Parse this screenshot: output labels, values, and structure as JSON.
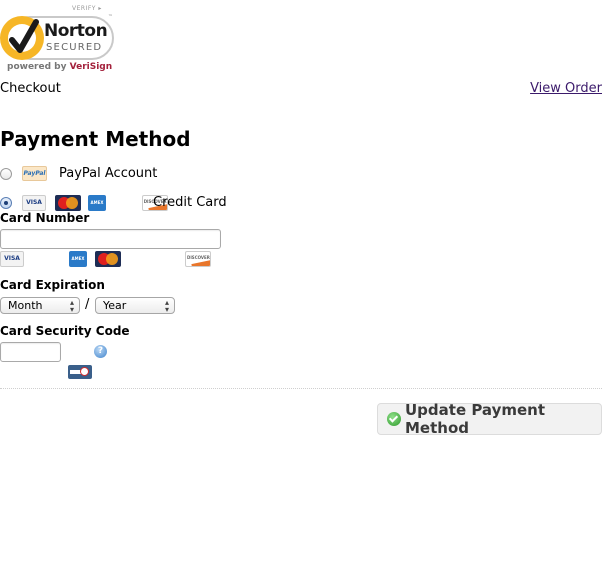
{
  "badge": {
    "verify": "VERIFY ▸",
    "brand": "Norton",
    "secured": "SECURED",
    "trademark": "™",
    "powered_by": "powered by",
    "powered_brand": "VeriSign"
  },
  "header": {
    "checkout": "Checkout",
    "view_order": "View Order"
  },
  "title": "Payment Method",
  "payment_options": [
    {
      "label": "PayPal Account",
      "selected": false,
      "icons": [
        "paypal"
      ]
    },
    {
      "label": "Credit Card",
      "selected": true,
      "icons": [
        "visa",
        "mastercard",
        "amex",
        "discover"
      ]
    }
  ],
  "card_icons": {
    "visa": "VISA",
    "paypal": "PayPal",
    "amex": "AMEX",
    "discover": "DISCOVER"
  },
  "form": {
    "card_number_label": "Card Number",
    "card_number_value": "",
    "expiration_label": "Card Expiration",
    "month_value": "Month",
    "separator": "/",
    "year_value": "Year",
    "security_code_label": "Card Security Code",
    "security_code_value": "",
    "help_glyph": "?"
  },
  "actions": {
    "update_label": "Update Payment Method"
  }
}
